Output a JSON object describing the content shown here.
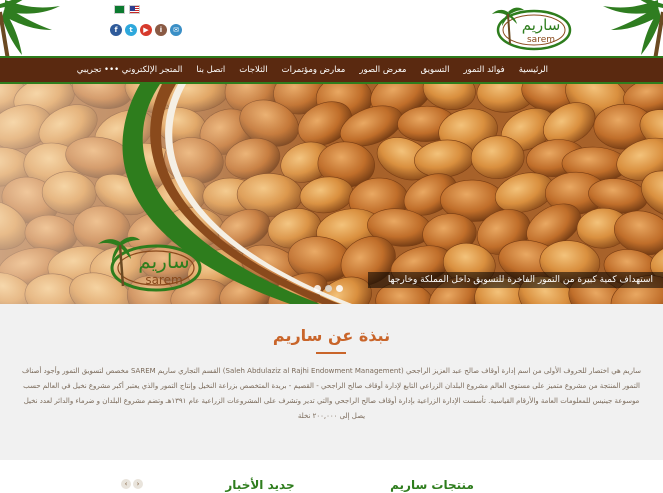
{
  "header": {
    "languages": [
      "العربية",
      "English"
    ],
    "social": [
      "f",
      "t",
      "▶",
      "i",
      "✉"
    ]
  },
  "logo": {
    "arabic": "ساريم",
    "latin": "sarem"
  },
  "nav": {
    "items": [
      {
        "label": "الرئيسية",
        "active": false
      },
      {
        "label": "فوائد التمور",
        "active": false
      },
      {
        "label": "التسويق",
        "active": false
      },
      {
        "label": "معرض الصور",
        "active": false
      },
      {
        "label": "معارض ومؤتمرات",
        "active": false
      },
      {
        "label": "الثلاجات",
        "active": false
      },
      {
        "label": "اتصل بنا",
        "active": false
      },
      {
        "label": "المتجر الإلكتروني ••• تجريبي",
        "active": false
      }
    ]
  },
  "hero": {
    "caption": "استهداف كمية كبيرة من التمور الفاخرة للتسويق داخل المملكة وخارجها",
    "slides": 3,
    "active_slide": 2
  },
  "about": {
    "title": "نبذة عن ساريم",
    "text": "ساريم هي اختصار للحروف الأولى من اسم إدارة أوقاف صالح عبد العزيز الراجحي (Saleh Abdulaziz al Rajhi Endowment Management) القسم التجاري ساريم SAREM مخصص لتسويق التمور وأجود أصناف التمور المنتجة من مشروع متميز على مستوى العالم مشروع البلدان الزراعي التابع لإدارة أوقاف صالح الراجحي - القصيم - بريدة المتخصص بزراعة النخيل وإنتاج التمور والذي يعتبر أكبر مشروع نخيل في العالم حسب موسوعة جينيس للمعلومات العامة والأرقام القياسية. تأسست الإدارة الزراعية بإدارة أوقاف صالح الراجحي والتي تدير وتشرف على المشروعات الزراعية عام ١٣٩١هـ وتضم مشروع البلدان و ضرماء والدائر لعدد نخيل يصل إلى ٢٠٠,٠٠٠ نخلة"
  },
  "sections": {
    "products_title": "منتجات ساريم",
    "news_title": "جديد الأخبار",
    "prev_arrow": "‹",
    "next_arrow": "›"
  },
  "colors": {
    "nav_bg": "#5a2910",
    "nav_border": "#2e7d1d",
    "accent_orange": "#c9652a",
    "accent_green": "#2e7d1d"
  }
}
